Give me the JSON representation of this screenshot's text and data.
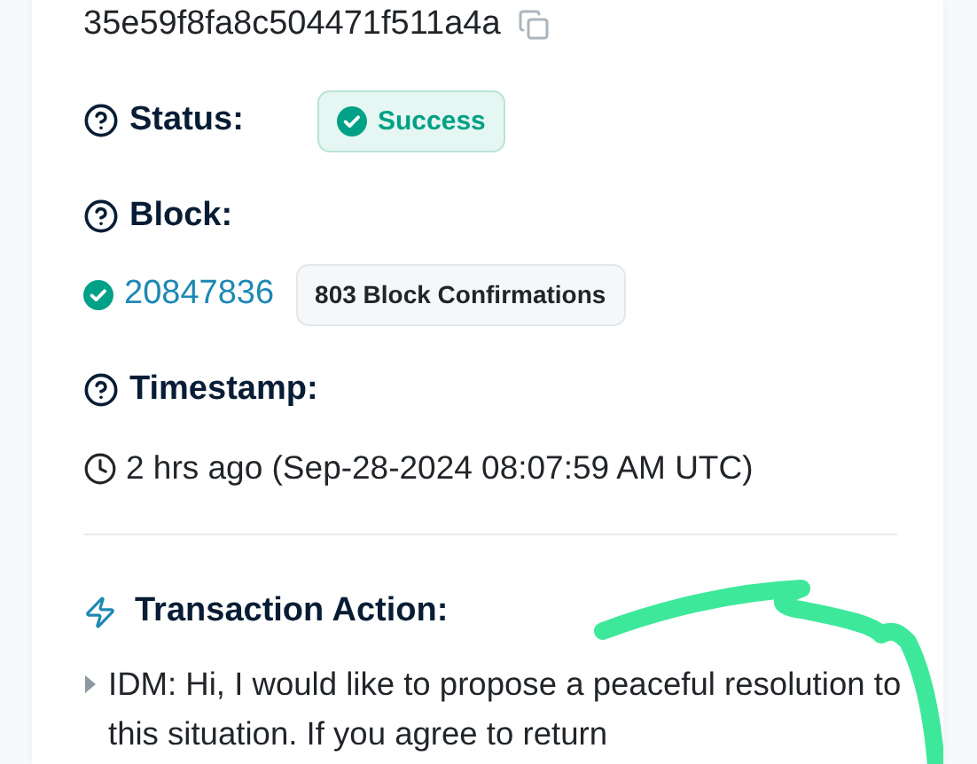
{
  "hash": "35e59f8fa8c504471f511a4a",
  "status": {
    "label": "Status:",
    "value": "Success"
  },
  "block": {
    "label": "Block:",
    "number": "20847836",
    "confirmations": "803 Block Confirmations"
  },
  "timestamp": {
    "label": "Timestamp:",
    "value": "2 hrs ago (Sep-28-2024 08:07:59 AM UTC)"
  },
  "transaction_action": {
    "label": "Transaction Action:",
    "message": "IDM: Hi, I would like to propose a peaceful resolution to this situation. If you agree to return"
  }
}
